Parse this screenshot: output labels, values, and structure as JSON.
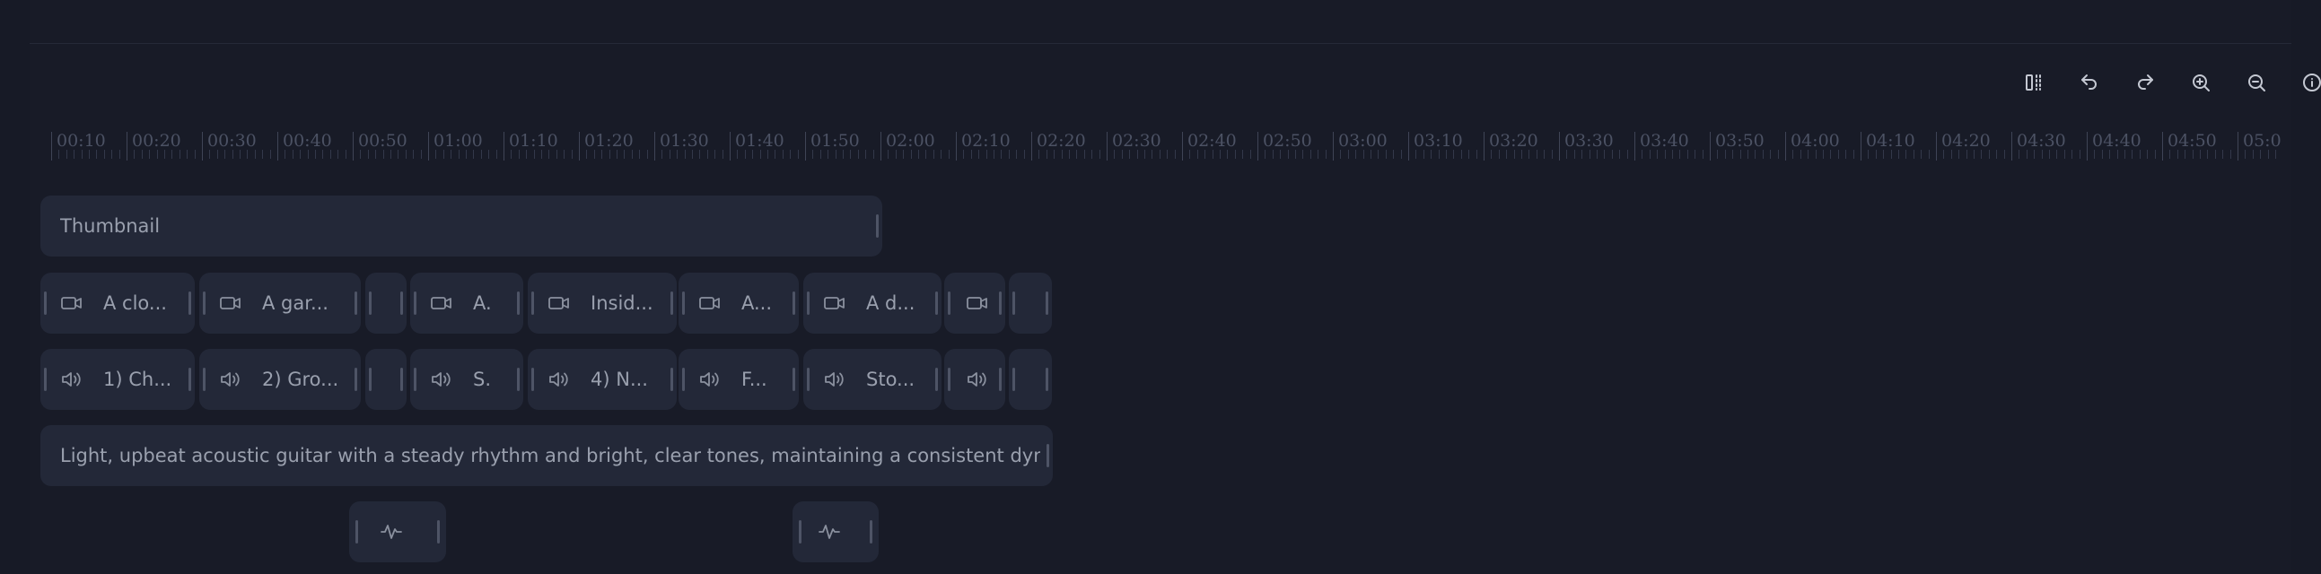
{
  "toolbar": {
    "buttons": [
      {
        "name": "split-button",
        "icon": "split-icon"
      },
      {
        "name": "undo-button",
        "icon": "undo-icon"
      },
      {
        "name": "redo-button",
        "icon": "redo-icon"
      },
      {
        "name": "zoom-in-button",
        "icon": "zoom-in-icon"
      },
      {
        "name": "zoom-out-button",
        "icon": "zoom-out-icon"
      },
      {
        "name": "info-button",
        "icon": "info-icon"
      }
    ]
  },
  "ruler": {
    "labels": [
      "00:10",
      "00:20",
      "00:30",
      "00:40",
      "00:50",
      "01:00",
      "01:10",
      "01:20",
      "01:30",
      "01:40",
      "01:50",
      "02:00",
      "02:10",
      "02:20",
      "02:30",
      "02:40",
      "02:50",
      "03:00",
      "03:10",
      "03:20",
      "03:30",
      "03:40",
      "03:50",
      "04:00",
      "04:10",
      "04:20",
      "04:30",
      "04:40",
      "04:50",
      "05:0"
    ]
  },
  "tracks": {
    "thumbnail": {
      "label": "Thumbnail"
    },
    "video": [
      {
        "label": "A clo...",
        "icon": "video-camera-icon"
      },
      {
        "label": "A gar...",
        "icon": "video-camera-icon"
      },
      {
        "label": "",
        "icon": ""
      },
      {
        "label": "A.",
        "icon": "video-camera-icon"
      },
      {
        "label": "Insid...",
        "icon": "video-camera-icon"
      },
      {
        "label": "A...",
        "icon": "video-camera-icon"
      },
      {
        "label": "A d...",
        "icon": "video-camera-icon"
      },
      {
        "label": "",
        "icon": "video-camera-icon"
      },
      {
        "label": "",
        "icon": ""
      }
    ],
    "audio": [
      {
        "label": "1) Ch...",
        "icon": "speaker-icon"
      },
      {
        "label": "2) Gro...",
        "icon": "speaker-icon"
      },
      {
        "label": "",
        "icon": ""
      },
      {
        "label": "S.",
        "icon": "speaker-icon"
      },
      {
        "label": "4) N...",
        "icon": "speaker-icon"
      },
      {
        "label": "F...",
        "icon": "speaker-icon"
      },
      {
        "label": "Sto...",
        "icon": "speaker-icon"
      },
      {
        "label": "",
        "icon": "speaker-icon"
      },
      {
        "label": "",
        "icon": ""
      }
    ],
    "music": {
      "label": "Light, upbeat acoustic guitar with a steady rhythm and bright, clear tones, maintaining a consistent dynamic level..."
    },
    "effects": [
      {
        "icon": "sound-wave-icon"
      },
      {
        "icon": "sound-wave-icon"
      }
    ]
  },
  "colors": {
    "background": "#171a26",
    "clip": "#232838",
    "text": "#9aa0ae"
  }
}
